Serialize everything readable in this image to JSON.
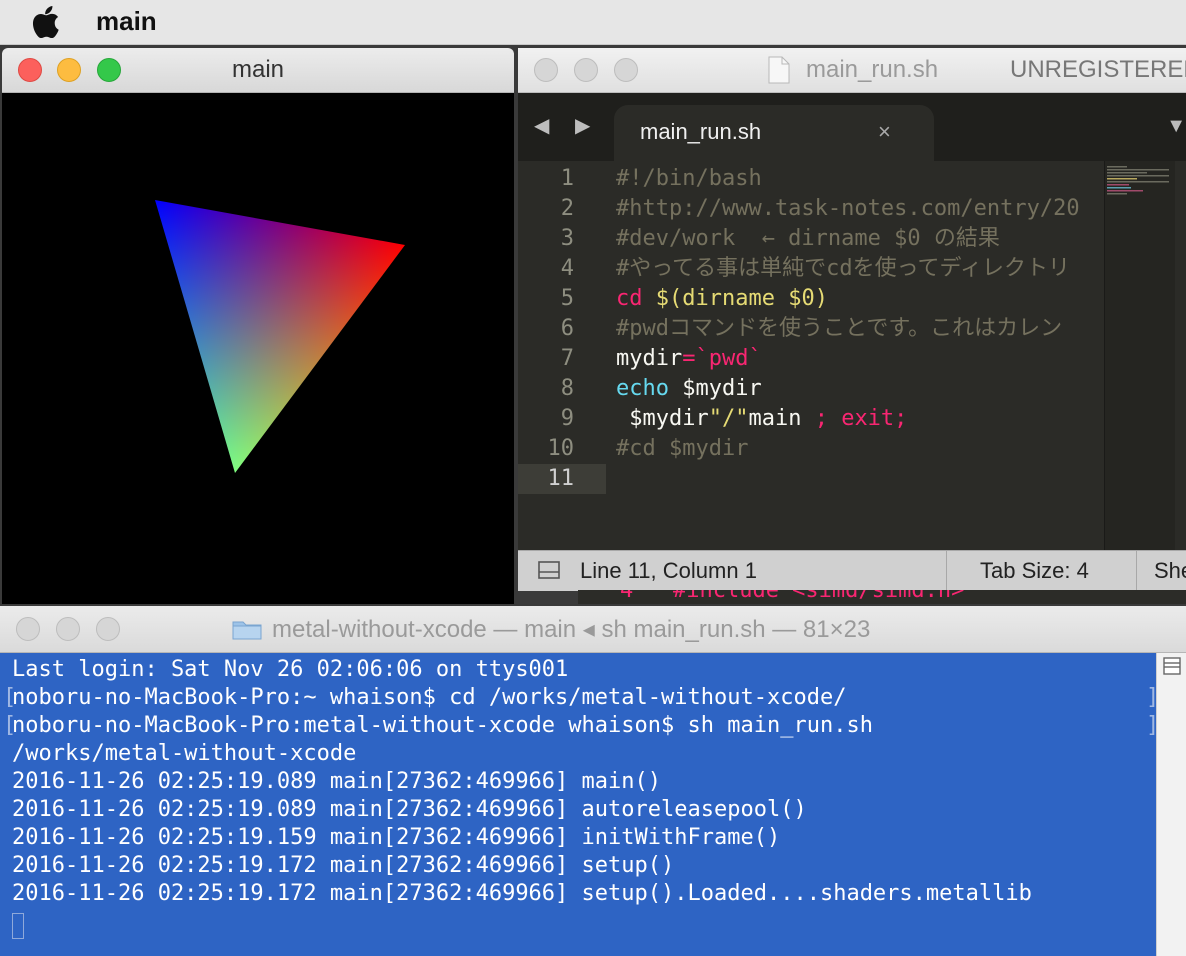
{
  "menubar": {
    "app_name": "main"
  },
  "metal_window": {
    "title": "main",
    "triangle_colors": [
      "#0000ff",
      "#ff0000",
      "#00ff00"
    ]
  },
  "sublime": {
    "title": "main_run.sh",
    "unregistered": "UNREGISTERED",
    "nav_arrows": "◀ ▶",
    "tab_label": "main_run.sh",
    "tab_close": "×",
    "tab_menu": "▼",
    "line_numbers": [
      "1",
      "2",
      "3",
      "4",
      "5",
      "6",
      "7",
      "8",
      "9",
      "10",
      "11"
    ],
    "code": {
      "l1": "#!/bin/bash",
      "l2": "#http://www.task-notes.com/entry/20",
      "l3": "#dev/work  ← dirname $0 の結果",
      "l4": "#やってる事は単純でcdを使ってディレクトリ",
      "l5_cmd": "cd ",
      "l5_arg": "$(dirname $0)",
      "l6": "#pwdコマンドを使うことです。これはカレン",
      "l7_var": "mydir",
      "l7_eq": "=",
      "l7_val": "`pwd`",
      "l8_cmd": "echo",
      "l8_arg": " $mydir",
      "l9_a": " $mydir",
      "l9_b": "\"/\"",
      "l9_c": "main ",
      "l9_d": "; exit;",
      "l10": "#cd $mydir",
      "l11": ""
    },
    "status": {
      "position": "Line 11, Column 1",
      "tab_size": "Tab Size: 4",
      "syntax": "She"
    }
  },
  "background_editor": {
    "peek_text": "4   #include <simd/simd.h>"
  },
  "terminal": {
    "title": "metal-without-xcode — main ◂ sh main_run.sh — 81×23",
    "lines": [
      "Last login: Sat Nov 26 02:06:06 on ttys001",
      "noboru-no-MacBook-Pro:~ whaison$ cd /works/metal-without-xcode/",
      "noboru-no-MacBook-Pro:metal-without-xcode whaison$ sh main_run.sh",
      "/works/metal-without-xcode",
      "2016-11-26 02:25:19.089 main[27362:469966] main()",
      "2016-11-26 02:25:19.089 main[27362:469966] autoreleasepool()",
      "2016-11-26 02:25:19.159 main[27362:469966] initWithFrame()",
      "2016-11-26 02:25:19.172 main[27362:469966] setup()",
      "2016-11-26 02:25:19.172 main[27362:469966] setup().Loaded....shaders.metallib"
    ]
  }
}
